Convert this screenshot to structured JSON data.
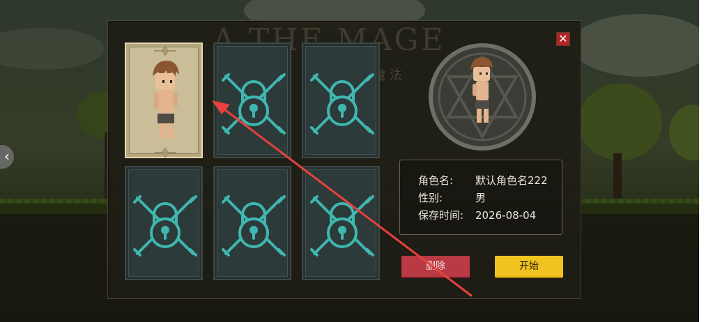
{
  "modal": {
    "watermark": "A  THE MAGE",
    "watermark_sub": "魔  法",
    "close_symbol": "✕"
  },
  "slots": [
    {
      "state": "character",
      "selected": true
    },
    {
      "state": "locked",
      "icon": "padlock-chain-icon"
    },
    {
      "state": "locked",
      "icon": "padlock-chain-icon"
    },
    {
      "state": "locked",
      "icon": "padlock-chain-icon"
    },
    {
      "state": "locked",
      "icon": "padlock-chain-icon"
    },
    {
      "state": "locked",
      "icon": "padlock-chain-icon"
    }
  ],
  "info": {
    "name_label": "角色名:",
    "name_value": "默认角色名222",
    "gender_label": "性别:",
    "gender_value": "男",
    "time_label": "保存时间:",
    "time_value": "2026-08-04"
  },
  "buttons": {
    "delete": "删除",
    "start": "开始"
  },
  "nav": {
    "back_symbol": "‹"
  },
  "colors": {
    "delete_button": "#b93a44",
    "start_button": "#f1c320",
    "lock_icon": "#3fb7b0",
    "annotation_arrow": "#e8413e"
  }
}
